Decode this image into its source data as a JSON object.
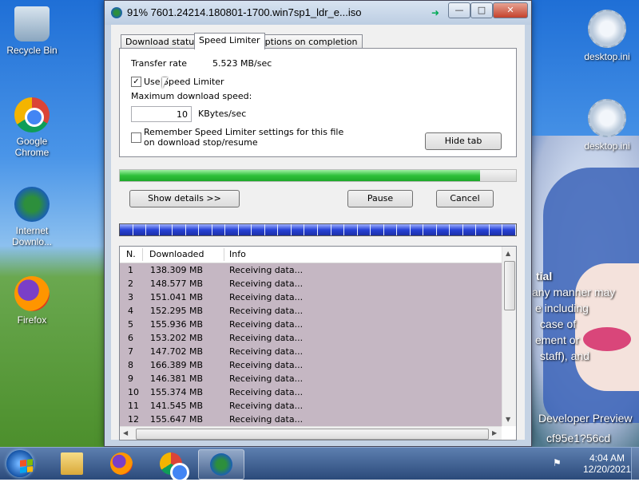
{
  "window": {
    "title": "91% 7601.24214.180801-1700.win7sp1_ldr_e...iso",
    "pin_icon": "pin-icon",
    "controls": [
      "minimize",
      "maximize",
      "close"
    ]
  },
  "tabs": [
    "Download status",
    "Speed Limiter",
    "Options on completion"
  ],
  "active_tab": "Speed Limiter",
  "speed_limiter": {
    "transfer_rate_label": "Transfer rate",
    "transfer_rate_value": "5.523  MB/sec",
    "use_limiter_label": "Use Speed Limiter",
    "use_limiter_checked": true,
    "max_speed_label": "Maximum download speed:",
    "max_speed_value": "10",
    "max_speed_unit": "KBytes/sec",
    "remember_label_line1": "Remember Speed Limiter settings for this file",
    "remember_label_line2": "on download stop/resume",
    "remember_checked": false,
    "hide_tab_label": "Hide tab"
  },
  "progress": {
    "percent": 91
  },
  "buttons": {
    "show_details": "Show details >>",
    "pause": "Pause",
    "cancel": "Cancel"
  },
  "segments": {
    "count": 30
  },
  "connections": {
    "headers": [
      "N.",
      "Downloaded",
      "Info"
    ],
    "rows": [
      {
        "n": "1",
        "downloaded": "138.309  MB",
        "info": "Receiving data..."
      },
      {
        "n": "2",
        "downloaded": "148.577  MB",
        "info": "Receiving data..."
      },
      {
        "n": "3",
        "downloaded": "151.041  MB",
        "info": "Receiving data..."
      },
      {
        "n": "4",
        "downloaded": "152.295  MB",
        "info": "Receiving data..."
      },
      {
        "n": "5",
        "downloaded": "155.936  MB",
        "info": "Receiving data..."
      },
      {
        "n": "6",
        "downloaded": "153.202  MB",
        "info": "Receiving data..."
      },
      {
        "n": "7",
        "downloaded": "147.702  MB",
        "info": "Receiving data..."
      },
      {
        "n": "8",
        "downloaded": "166.389  MB",
        "info": "Receiving data..."
      },
      {
        "n": "9",
        "downloaded": "146.381  MB",
        "info": "Receiving data..."
      },
      {
        "n": "10",
        "downloaded": "155.374  MB",
        "info": "Receiving data..."
      },
      {
        "n": "11",
        "downloaded": "141.545  MB",
        "info": "Receiving data..."
      },
      {
        "n": "12",
        "downloaded": "155.647  MB",
        "info": "Receiving data..."
      }
    ]
  },
  "desktop": {
    "icons_left": [
      "Recycle Bin",
      "Google Chrome",
      "Internet Downlo...",
      "Firefox"
    ],
    "icons_right": [
      "desktop.ini",
      "desktop.ini"
    ],
    "overlay_text": [
      "tial",
      "any manner may",
      "e including",
      "case of",
      "ement or",
      "staff), and",
      "Developer Preview",
      "cf95e1?56cd"
    ]
  },
  "taskbar": {
    "time": "4:04 AM",
    "date": "12/20/2021",
    "apps": [
      "explorer",
      "firefox",
      "chrome",
      "internet-download-manager"
    ]
  },
  "colors": {
    "progress_fill": "#2ec03a",
    "segment_blue": "#2742d6",
    "list_rows_bg": "#c5b7c3"
  }
}
